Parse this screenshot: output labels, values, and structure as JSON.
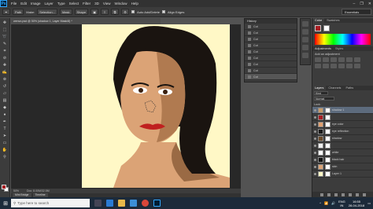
{
  "menubar": {
    "logo": "Ps",
    "items": [
      "File",
      "Edit",
      "Image",
      "Layer",
      "Type",
      "Select",
      "Filter",
      "3D",
      "View",
      "Window",
      "Help"
    ],
    "win_controls": [
      "–",
      "❐",
      "✕"
    ]
  },
  "options": {
    "brush_size": "60",
    "edit_btn": "Path",
    "make_btn": "Make:",
    "selection_btn": "Selection...",
    "mask_btn": "Mask",
    "shape_btn": "Shape",
    "auto_add_delete": "Auto Add/Delete",
    "align_edges": "Align Edges",
    "workspace": "Essentials"
  },
  "document": {
    "tab_title": "wenvo.psd @ 50% (shadow 1, Layer Mask/8) *",
    "zoom": "50%",
    "doc_info": "Doc: 8.00M/32.5M"
  },
  "bottom_tabs": [
    "Mini Bridge",
    "Timeline"
  ],
  "history": {
    "title": "History",
    "items": [
      "Cut",
      "Cut",
      "Cut",
      "Cut",
      "Cut",
      "Cut",
      "Cut",
      "Cut",
      "Cut"
    ]
  },
  "color_panel": {
    "tabs": [
      "Color",
      "Swatches"
    ],
    "fg_color": "#a81d22",
    "bg_color": "#ffffff"
  },
  "adjustments": {
    "tabs": [
      "Adjustments",
      "Styles"
    ],
    "subtitle": "Add an adjustment"
  },
  "layers_panel": {
    "tabs": [
      "Layers",
      "Channels",
      "Paths"
    ],
    "kind_label": "Kind",
    "blend_mode": "Normal",
    "lock_label": "Lock:",
    "layers": [
      {
        "name": "shadow 1",
        "color": "#c79b6a",
        "active": true
      },
      {
        "name": "",
        "color": "#a81d22",
        "active": false
      },
      {
        "name": "eye color",
        "color": "#e0a070",
        "active": false
      },
      {
        "name": "eye reflection",
        "color": "#1a1a1a",
        "active": false
      },
      {
        "name": "shadow",
        "color": "#6a4a2a",
        "active": false
      },
      {
        "name": "",
        "color": "#f0f0f0",
        "active": false
      },
      {
        "name": "white",
        "color": "#ffffff",
        "active": false
      },
      {
        "name": "black hair",
        "color": "#111111",
        "active": false
      },
      {
        "name": "skin",
        "color": "#dba376",
        "active": false
      },
      {
        "name": "Layer 1",
        "color": "#fff8c6",
        "active": false
      }
    ]
  },
  "taskbar": {
    "search_placeholder": "Type here to search",
    "lang": "ENG",
    "region": "IN",
    "time": "16:55",
    "date": "28-04-2018"
  }
}
